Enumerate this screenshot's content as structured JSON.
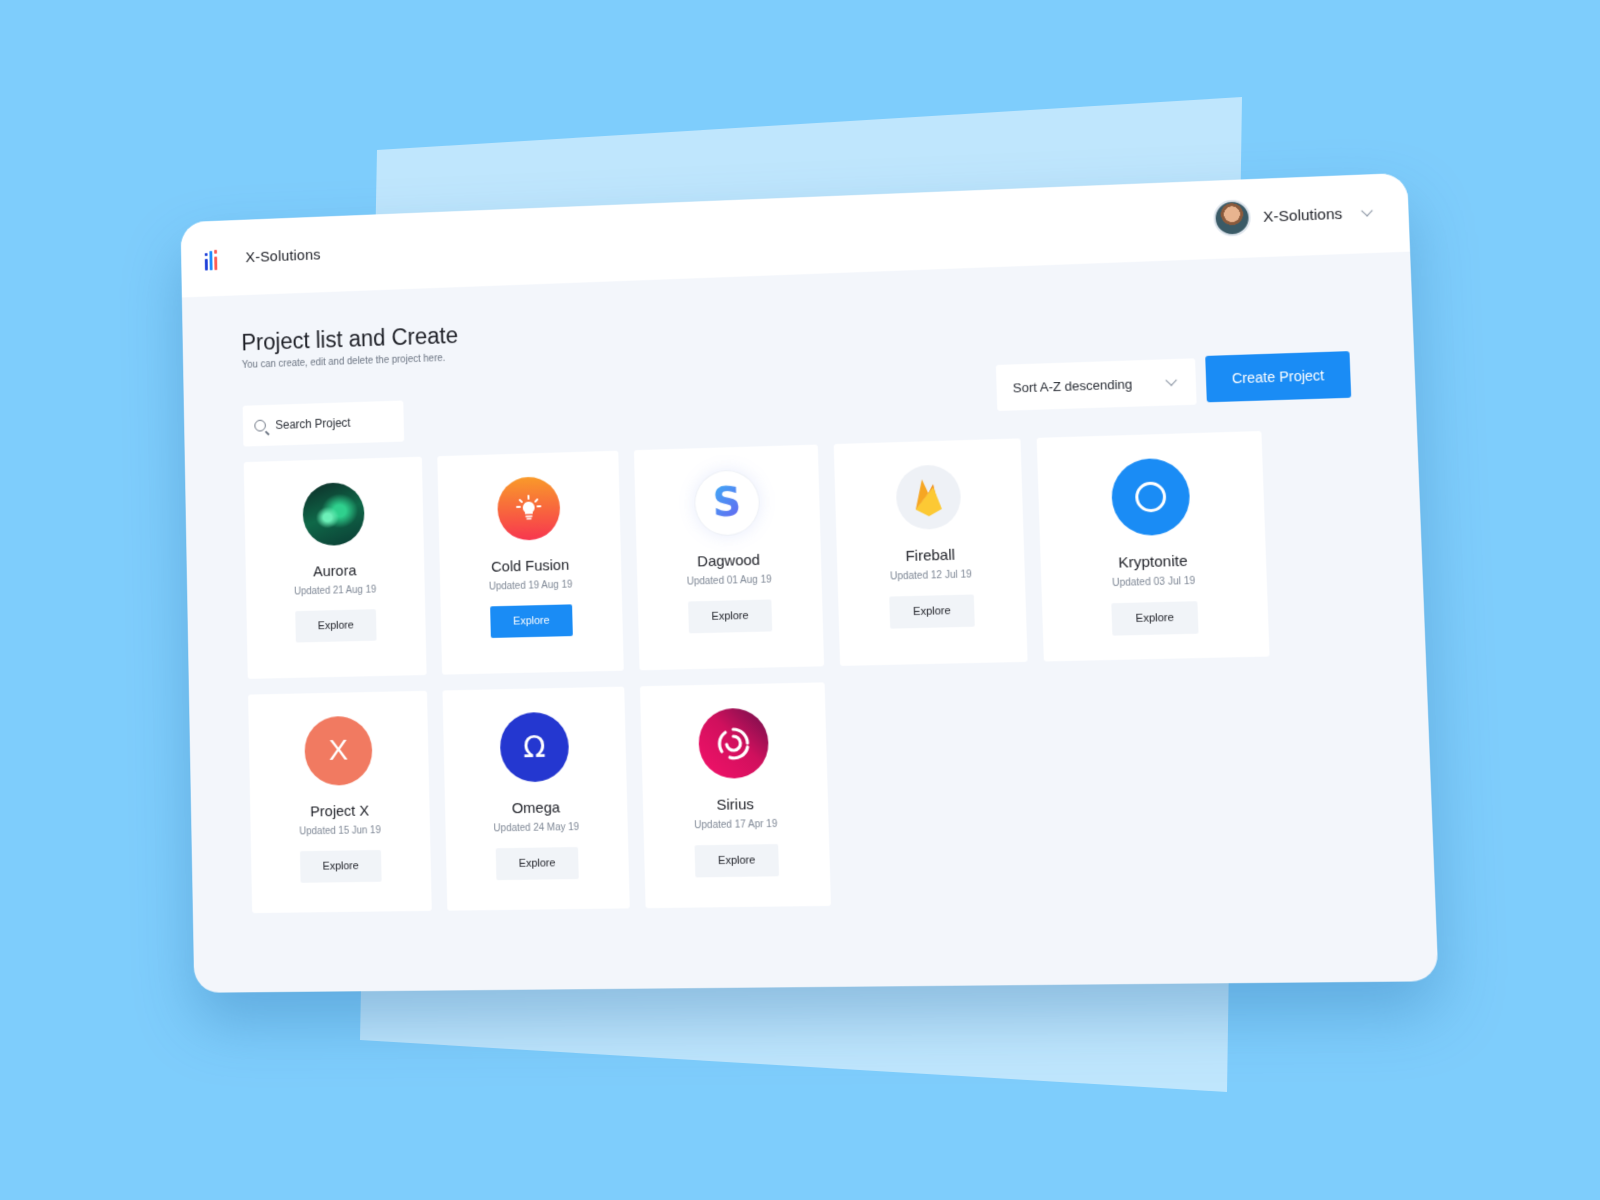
{
  "app": {
    "brand": "X-Solutions",
    "user": {
      "name": "X-Solutions",
      "avatar": "user-avatar-photo"
    }
  },
  "page": {
    "title": "Project list and Create",
    "subtitle": "You can create, edit and delete the project here."
  },
  "controls": {
    "search_placeholder": "Search Project",
    "sort": {
      "selected": "Sort A-Z descending"
    },
    "create_label": "Create Project"
  },
  "colors": {
    "background": "#7ecdfc",
    "accent": "#1a8cf5",
    "surface": "#f3f6fb"
  },
  "projects": [
    {
      "name": "Aurora",
      "updated": "Updated 21 Aug 19",
      "icon": "aurora-image-icon",
      "action": "Explore",
      "active": false
    },
    {
      "name": "Cold Fusion",
      "updated": "Updated 19 Aug 19",
      "icon": "lightbulb-icon",
      "action": "Explore",
      "active": true
    },
    {
      "name": "Dagwood",
      "updated": "Updated 01 Aug 19",
      "icon": "letter-s-icon",
      "glyph": "S",
      "action": "Explore",
      "active": false
    },
    {
      "name": "Fireball",
      "updated": "Updated 12 Jul 19",
      "icon": "flame-icon",
      "action": "Explore",
      "active": false
    },
    {
      "name": "Kryptonite",
      "updated": "Updated 03 Jul 19",
      "icon": "ring-icon",
      "action": "Explore",
      "active": false
    },
    {
      "name": "Project X",
      "updated": "Updated 15 Jun 19",
      "icon": "letter-x-icon",
      "glyph": "X",
      "action": "Explore",
      "active": false
    },
    {
      "name": "Omega",
      "updated": "Updated 24 May 19",
      "icon": "omega-icon",
      "glyph": "Ω",
      "action": "Explore",
      "active": false
    },
    {
      "name": "Sirius",
      "updated": "Updated 17 Apr 19",
      "icon": "swirl-icon",
      "action": "Explore",
      "active": false
    }
  ]
}
